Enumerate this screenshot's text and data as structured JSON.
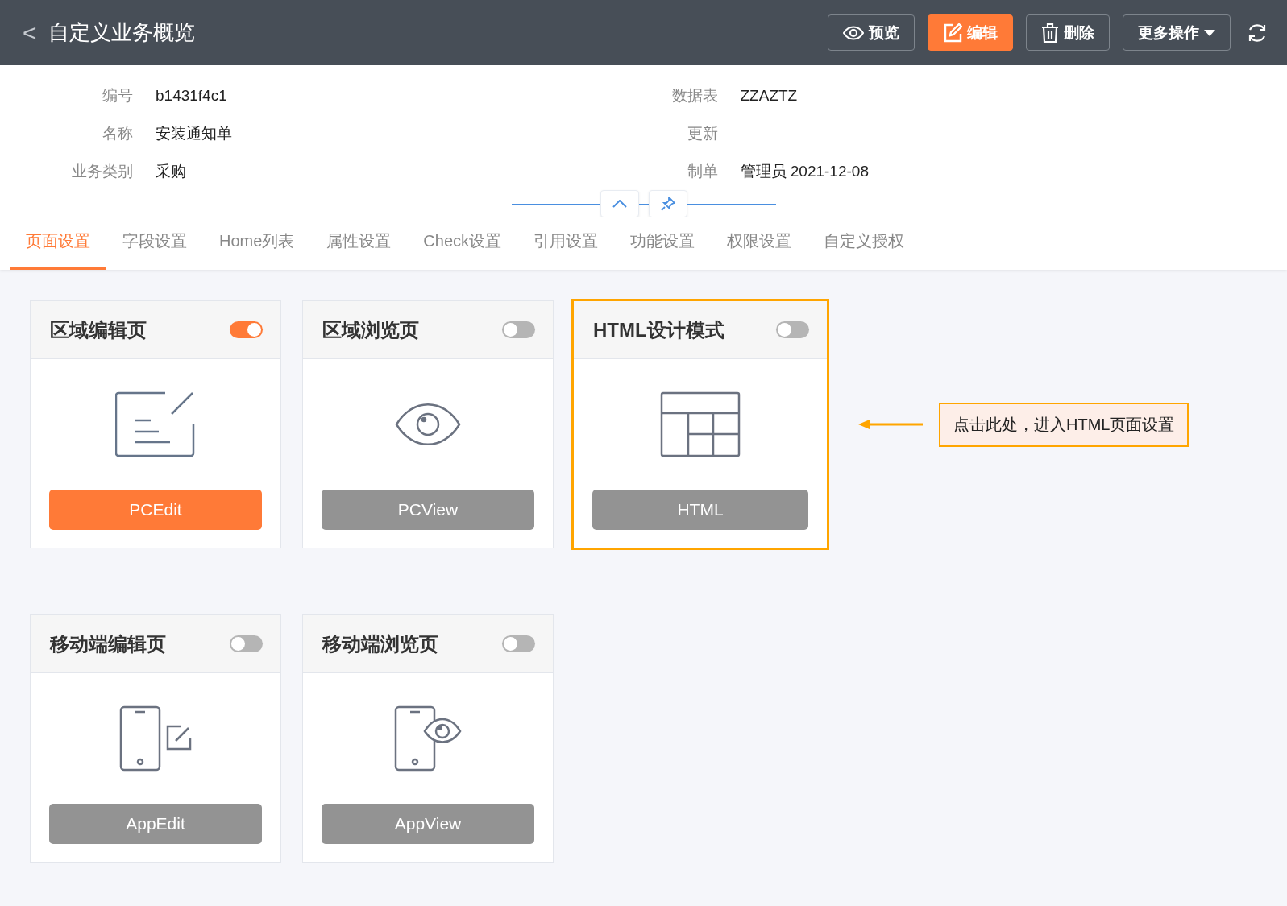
{
  "header": {
    "back": "<",
    "title": "自定义业务概览",
    "actions": [
      {
        "kind": "preview",
        "label": "预览",
        "primary": false
      },
      {
        "kind": "edit",
        "label": "编辑",
        "primary": true
      },
      {
        "kind": "delete",
        "label": "删除",
        "primary": false
      },
      {
        "kind": "more",
        "label": "更多操作",
        "primary": false
      }
    ]
  },
  "info": {
    "left": [
      {
        "label": "编号",
        "value": "b1431f4c1"
      },
      {
        "label": "名称",
        "value": "安装通知单"
      },
      {
        "label": "业务类别",
        "value": "采购"
      }
    ],
    "right": [
      {
        "label": "数据表",
        "value": "ZZAZTZ"
      },
      {
        "label": "更新"
      },
      {
        "label": "制单",
        "value": "管理员 2021-12-08"
      }
    ]
  },
  "tabs": [
    {
      "label": "页面设置",
      "selected": true
    },
    {
      "label": "字段设置",
      "selected": false
    },
    {
      "label": "Home列表",
      "selected": false
    },
    {
      "label": "属性设置",
      "selected": false
    },
    {
      "label": "Check设置",
      "selected": false
    },
    {
      "label": "引用设置",
      "selected": false
    },
    {
      "label": "功能设置",
      "selected": false
    },
    {
      "label": "权限设置",
      "selected": false
    },
    {
      "label": "自定义授权",
      "selected": false
    }
  ],
  "card_rows": [
    [
      {
        "kind": "pc-edit",
        "title": "区域编辑页",
        "on": true,
        "button": "PCEdit",
        "highlighted": false
      },
      {
        "kind": "pc-view",
        "title": "区域浏览页",
        "on": false,
        "button": "PCView",
        "highlighted": false
      },
      {
        "kind": "html",
        "title": "HTML设计模式",
        "on": false,
        "button": "HTML",
        "highlighted": true
      }
    ],
    [
      {
        "kind": "app-edit",
        "title": "移动端编辑页",
        "on": false,
        "button": "AppEdit",
        "highlighted": false
      },
      {
        "kind": "app-view",
        "title": "移动端浏览页",
        "on": false,
        "button": "AppView",
        "highlighted": false
      }
    ]
  ],
  "callout": "点击此处，进入HTML页面设置"
}
